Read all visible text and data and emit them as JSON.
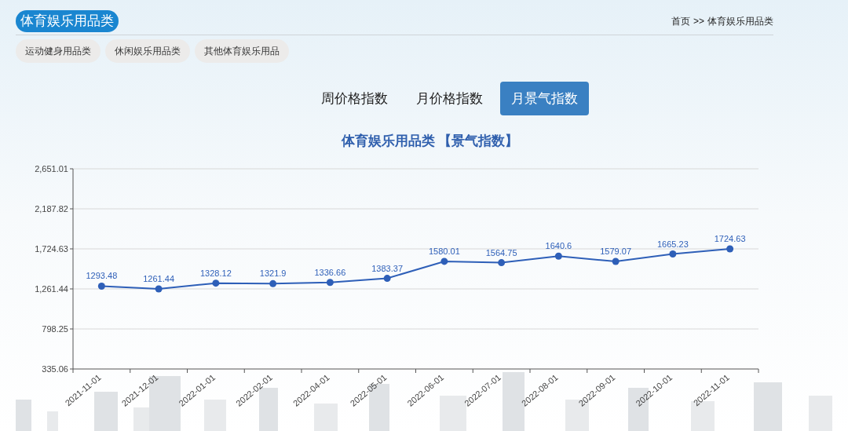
{
  "header": {
    "title": "体育娱乐用品类",
    "breadcrumb": {
      "home": "首页",
      "separator": ">>",
      "current": "体育娱乐用品类"
    }
  },
  "subcategories": [
    {
      "label": "运动健身用品类",
      "selected": false
    },
    {
      "label": "休闲娱乐用品类",
      "selected": false
    },
    {
      "label": "其他体育娱乐用品",
      "selected": false
    }
  ],
  "index_tabs": [
    {
      "label": "周价格指数",
      "selected": false
    },
    {
      "label": "月价格指数",
      "selected": false
    },
    {
      "label": "月景气指数",
      "selected": true
    }
  ],
  "chart": {
    "title": "体育娱乐用品类 【景气指数】",
    "chart_data": {
      "type": "line",
      "categories": [
        "2021-11-01",
        "2021-12-01",
        "2022-01-01",
        "2022-02-01",
        "2022-04-01",
        "2022-05-01",
        "2022-06-01",
        "2022-07-01",
        "2022-08-01",
        "2022-09-01",
        "2022-10-01",
        "2022-11-01"
      ],
      "grid": true,
      "series": [
        {
          "color": "#2e5fb8",
          "marker": true,
          "values": [
            1293.48,
            1261.44,
            1328.12,
            1321.9,
            1336.66,
            1383.37,
            1580.01,
            1564.75,
            1640.6,
            1579.07,
            1665.23,
            1724.63
          ]
        }
      ],
      "ylim": [
        335.06,
        2651.01
      ],
      "yticks": [
        {
          "value": 335.06,
          "label": "335.06"
        },
        {
          "value": 798.25,
          "label": "798.25"
        },
        {
          "value": 1261.44,
          "label": "1,261.44"
        },
        {
          "value": 1724.63,
          "label": "1,724.63"
        },
        {
          "value": 2187.82,
          "label": "2,187.82"
        },
        {
          "value": 2651.01,
          "label": "2,651.01"
        }
      ],
      "data_labels": true
    }
  }
}
